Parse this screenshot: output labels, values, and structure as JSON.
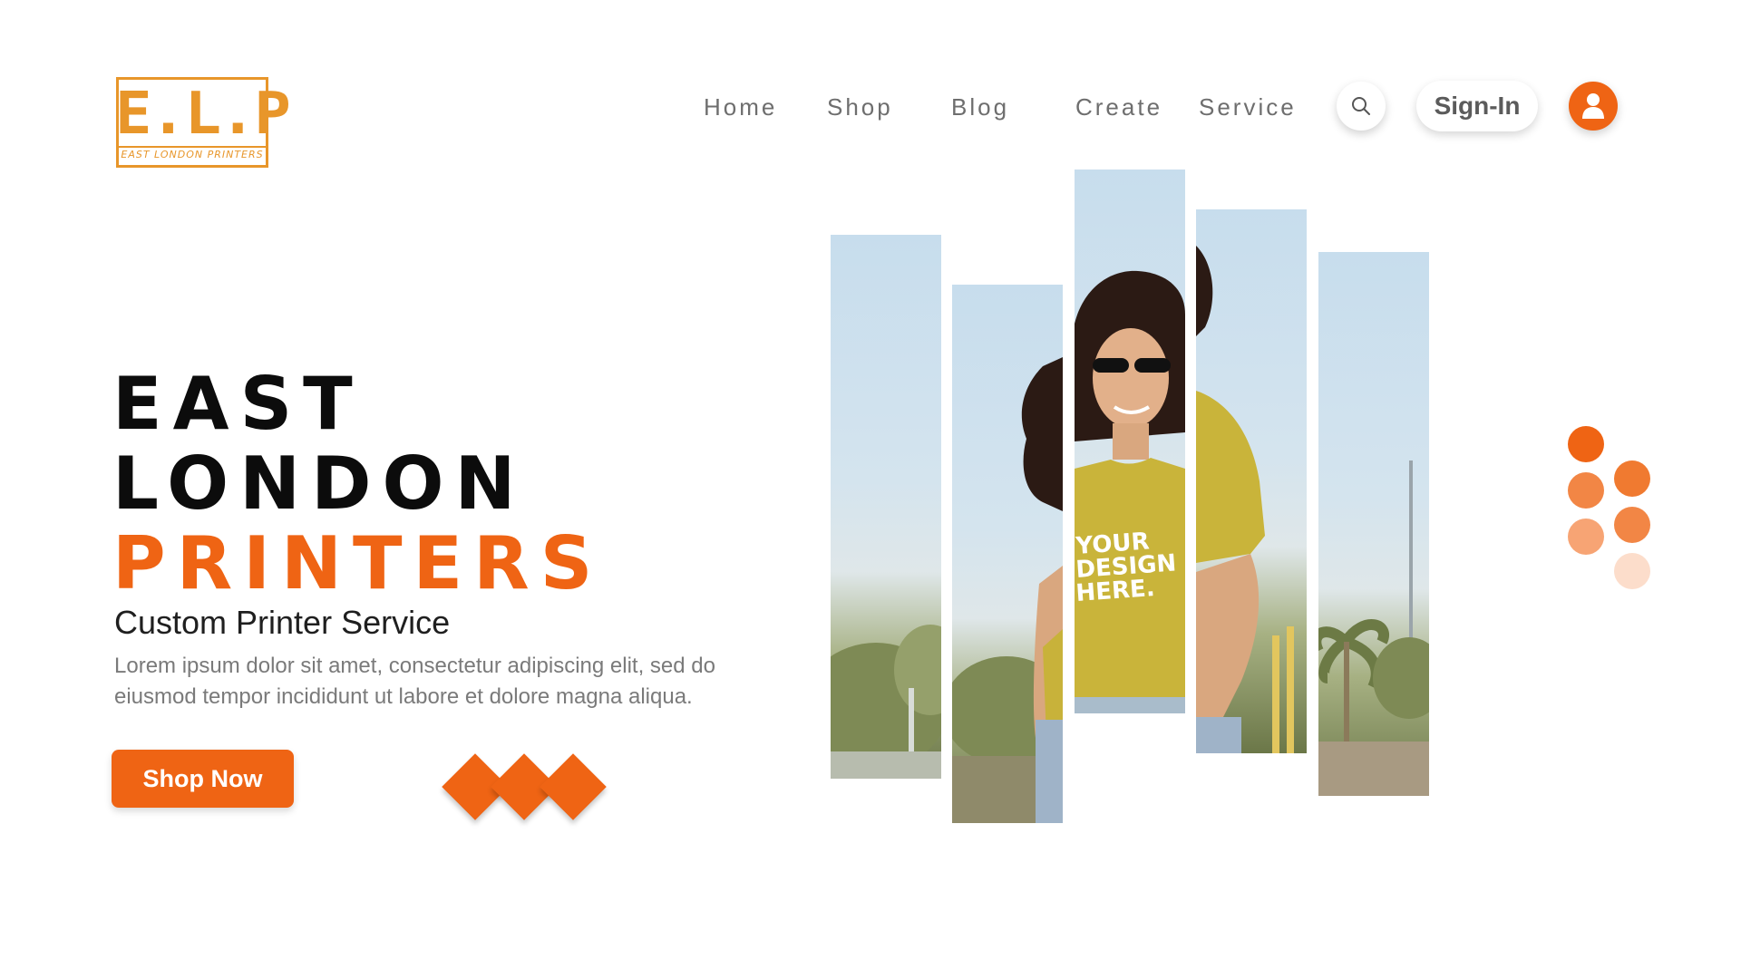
{
  "logo": {
    "mark": "E.L.P",
    "tagline": "EAST LONDON PRINTERS"
  },
  "nav": {
    "items": [
      {
        "label": "Home"
      },
      {
        "label": "Shop"
      },
      {
        "label": "Blog"
      },
      {
        "label": "Create"
      },
      {
        "label": "Service"
      }
    ],
    "search_icon": "search-icon",
    "signin_label": "Sign-In",
    "user_icon": "user-icon"
  },
  "hero": {
    "title_line1": "EAST",
    "title_line2": "LONDON",
    "title_line3": "PRINTERS",
    "subtitle": "Custom Printer Service",
    "description": "Lorem ipsum dolor sit amet, consectetur adipiscing elit, sed do eiusmod tempor incididunt ut labore et dolore magna aliqua.",
    "cta_label": "Shop Now"
  },
  "photo": {
    "shirt_print": "YOUR DESIGN HERE."
  },
  "colors": {
    "accent": "#ef6414",
    "logo": "#e8962a",
    "nav_text": "#6e6e6e",
    "heading": "#0c0c0c",
    "body_text": "#7a7a7a"
  }
}
